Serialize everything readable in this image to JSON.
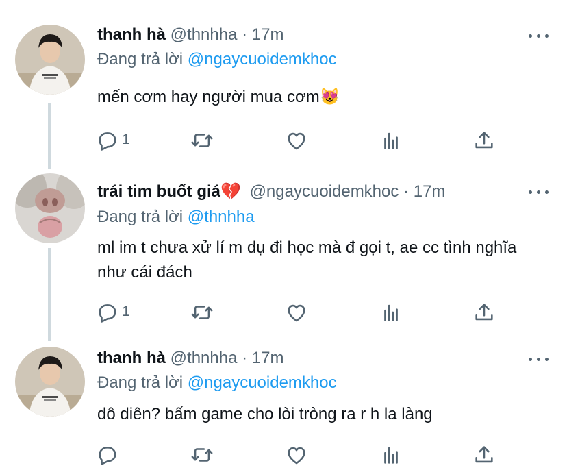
{
  "tweets": [
    {
      "name": "thanh hà",
      "handle": "@thnhha",
      "dot": "·",
      "time": "17m",
      "replying_prefix": "Đang trả lời",
      "replying_to": "@ngaycuoidemkhoc",
      "text": "mến cơm hay người mua cơm😻",
      "reply_count": "1",
      "avatar_icon": "person-in-white-shirt"
    },
    {
      "name": "trái tim buốt giá💔",
      "handle": "@ngaycuoidemkhoc",
      "dot": "·",
      "time": "17m",
      "replying_prefix": "Đang trả lời",
      "replying_to": "@thnhha",
      "text": "ml im t chưa xử lí m dụ đi học mà đ gọi t, ae cc tình nghĩa như cái đách",
      "reply_count": "1",
      "avatar_icon": "cat-closeup"
    },
    {
      "name": "thanh hà",
      "handle": "@thnhha",
      "dot": "·",
      "time": "17m",
      "replying_prefix": "Đang trả lời",
      "replying_to": "@ngaycuoidemkhoc",
      "text": "dô diên? bấm game cho lòi tròng ra r h la làng",
      "reply_count": "",
      "avatar_icon": "person-in-white-shirt"
    }
  ],
  "colors": {
    "accent": "#1d9bf0",
    "secondary_text": "#536471",
    "thread_line": "#cfd9de"
  },
  "icons": [
    "reply-icon",
    "retweet-icon",
    "like-icon",
    "views-icon",
    "share-icon",
    "more-icon"
  ]
}
